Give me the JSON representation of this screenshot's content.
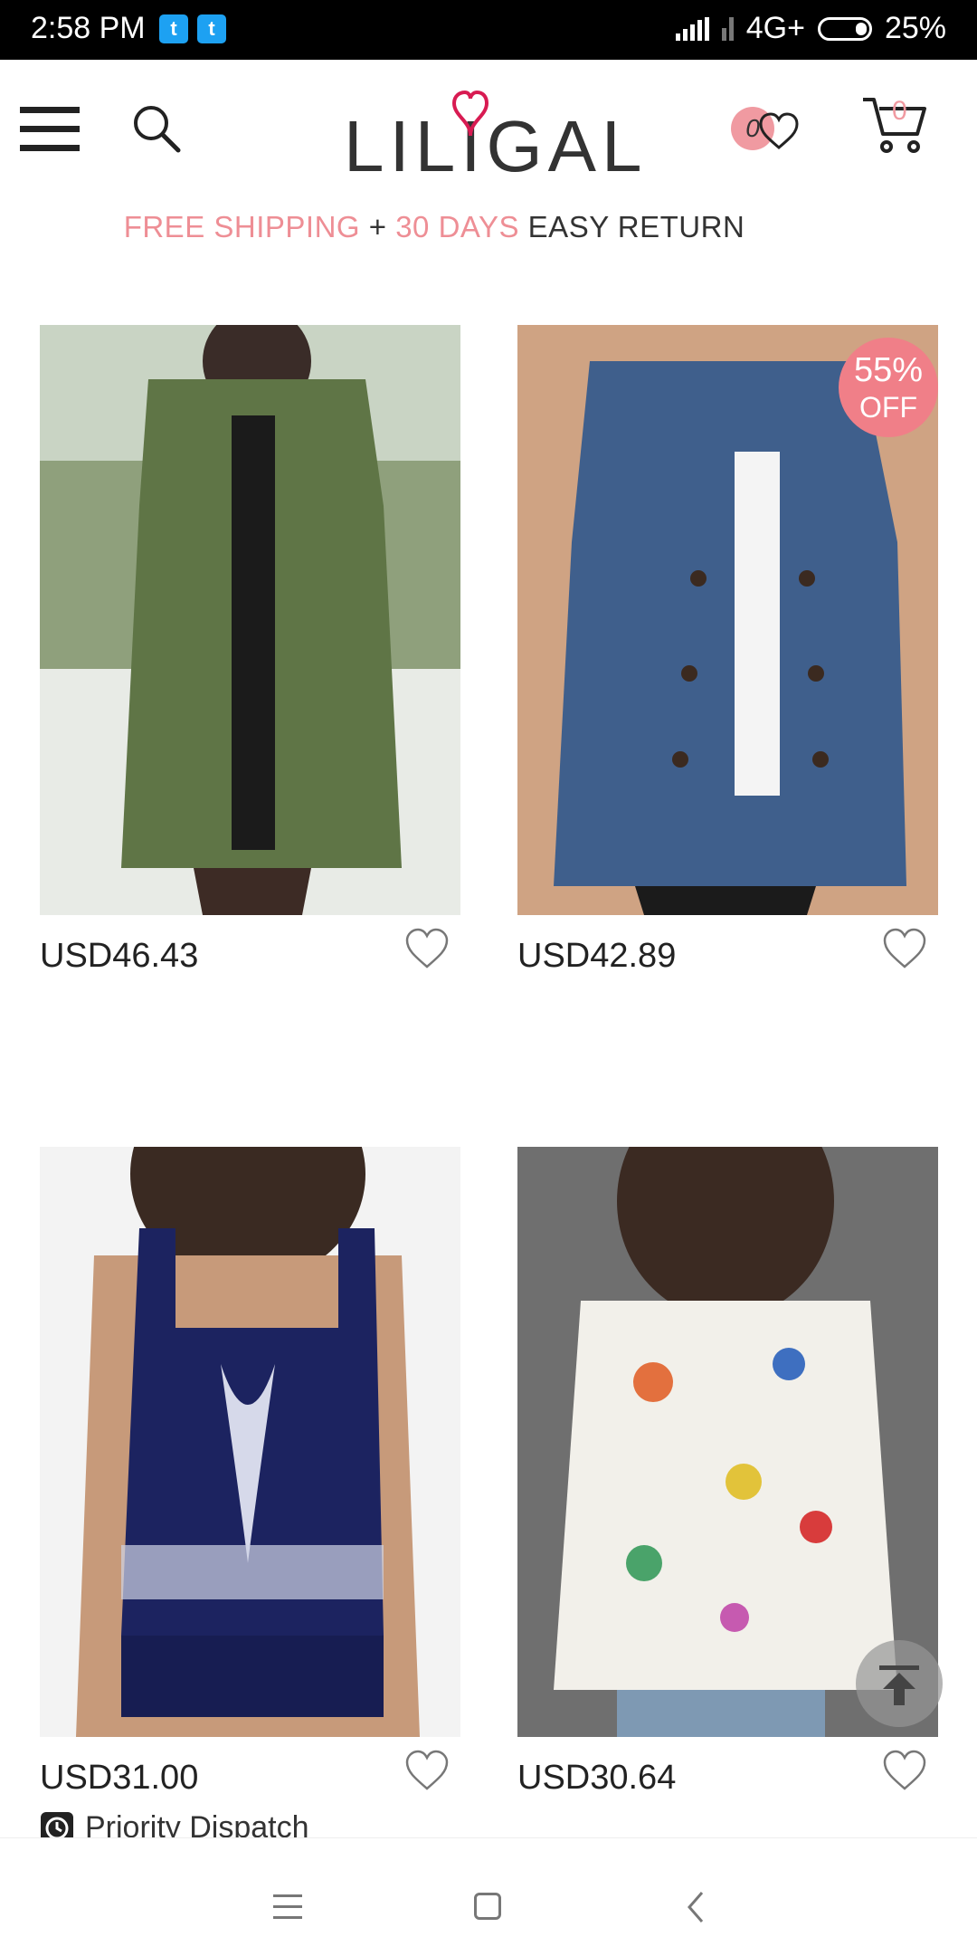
{
  "status_bar": {
    "time": "2:58 PM",
    "network": "4G+",
    "battery": "25%",
    "notification_icons": [
      "twitter-icon",
      "twitter-icon"
    ]
  },
  "header": {
    "logo": "LILIGAL",
    "wishlist_count": "0",
    "cart_count": "0"
  },
  "promo": {
    "part1": "FREE SHIPPING",
    "plus": "+",
    "part2": "30 DAYS",
    "part3": "EASY RETURN"
  },
  "products": [
    {
      "price": "USD46.43",
      "image": "green-hooded-coat"
    },
    {
      "price": "USD42.89",
      "image": "denim-trench-coat",
      "badge_top": "55%",
      "badge_bottom": "OFF"
    },
    {
      "price": "USD31.00",
      "image": "navy-printed-tankini",
      "tag": "Priority Dispatch"
    },
    {
      "price": "USD30.64",
      "image": "floral-v-neck-blouse"
    }
  ],
  "colors": {
    "accent_pink": "#ee8e95",
    "logo_heart": "#d81b52"
  }
}
